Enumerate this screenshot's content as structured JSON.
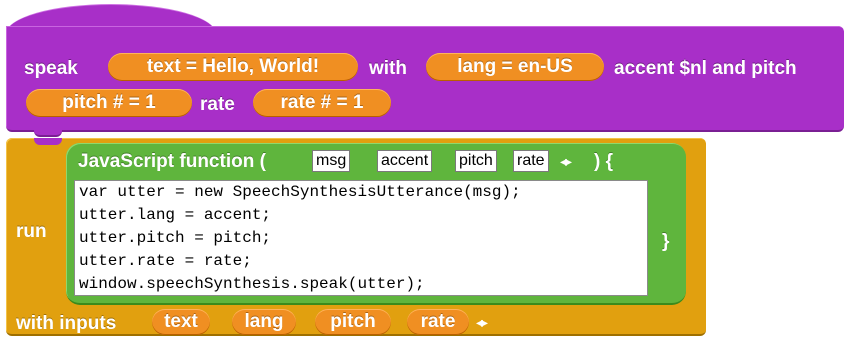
{
  "hat": {
    "speak": "speak",
    "text_slot": "text = Hello, World!",
    "with": "with",
    "lang_slot": "lang = en-US",
    "accent_and_pitch": "accent $nl and pitch",
    "pitch_slot": "pitch # = 1",
    "rate": "rate",
    "rate_slot": "rate # = 1"
  },
  "command": {
    "run": "run",
    "with_inputs": "with inputs",
    "inputs": [
      "text",
      "lang",
      "pitch",
      "rate"
    ],
    "arrows": "◂▸"
  },
  "js_function": {
    "title": "JavaScript function (",
    "params": [
      "msg",
      "accent",
      "pitch",
      "rate"
    ],
    "arrows": "◂▸",
    "close_paren_brace": ") {",
    "closing_brace": "}",
    "code_lines": [
      "var utter = new SpeechSynthesisUtterance(msg);",
      "utter.lang = accent;",
      "utter.pitch = pitch;",
      "utter.rate = rate;",
      "window.speechSynthesis.speak(utter);"
    ]
  },
  "colors": {
    "hat_block": "#a82fc8",
    "command_block": "#e1a00f",
    "js_ring": "#5fb53d",
    "slot": "#f08f22"
  }
}
